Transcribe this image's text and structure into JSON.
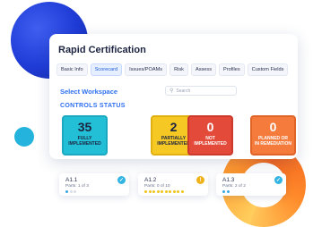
{
  "app": {
    "title": "Rapid Certification"
  },
  "tabs": [
    {
      "label": "Basic Info",
      "active": false
    },
    {
      "label": "Scorecard",
      "active": true
    },
    {
      "label": "Issues/POAMs",
      "active": false
    },
    {
      "label": "Risk",
      "active": false
    },
    {
      "label": "Assess",
      "active": false
    },
    {
      "label": "Profiles",
      "active": false
    },
    {
      "label": "Custom Fields",
      "active": false
    }
  ],
  "workspace": {
    "label": "Select Workspace"
  },
  "search": {
    "placeholder": "Search",
    "icon": "search-icon"
  },
  "controls": {
    "heading": "CONTROLS STATUS",
    "items": [
      {
        "count": "35",
        "label_line1": "FULLY",
        "label_line2": "IMPLEMENTED",
        "color": "#23bfd6"
      },
      {
        "count": "2",
        "label_line1": "PARTIALLY",
        "label_line2": "IMPLEMENTED",
        "color": "#f6c824"
      },
      {
        "count": "0",
        "label_line1": "NOT",
        "label_line2": "IMPLEMENTED",
        "color": "#e34a3a"
      },
      {
        "count": "0",
        "label_line1": "PLANNED OR",
        "label_line2": "IN REMEDIATION",
        "color": "#f47b3c"
      }
    ]
  },
  "subcards": [
    {
      "id": "A1.1",
      "parts": "Parts: 1 of 3",
      "icon": "check-circle-icon",
      "filled": 1,
      "total": 3,
      "dot_color": "#3aa7e0"
    },
    {
      "id": "A1.2",
      "parts": "Parts: 0 of 10",
      "icon": "warning-circle-icon",
      "filled": 10,
      "total": 10,
      "dot_color": "#f0c419"
    },
    {
      "id": "A1.3",
      "parts": "Parts: 2 of 2",
      "icon": "check-circle-icon",
      "filled": 2,
      "total": 2,
      "dot_color": "#3aa7e0"
    }
  ]
}
